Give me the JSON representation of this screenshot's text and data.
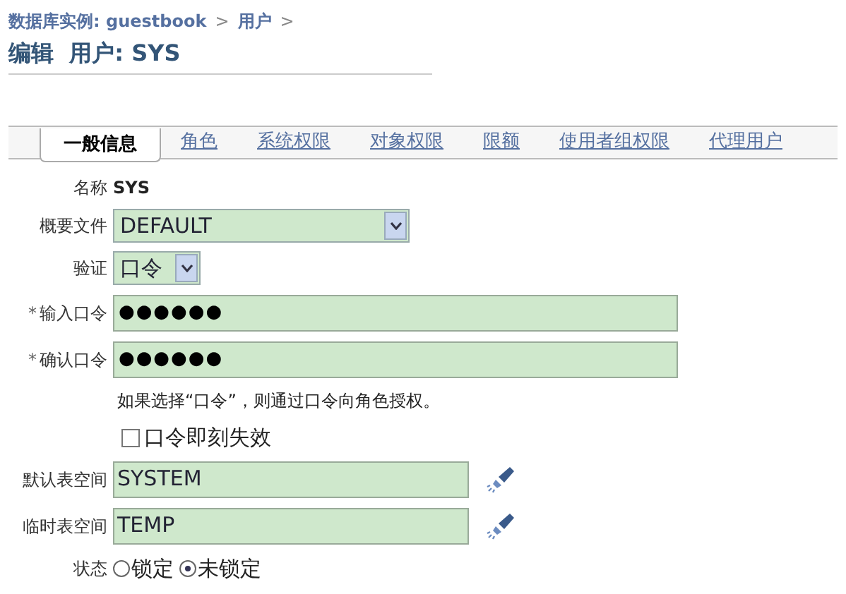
{
  "breadcrumb": [
    {
      "label": "数据库实例: guestbook"
    },
    {
      "label": "用户"
    }
  ],
  "breadcrumb_separator": ">",
  "title": "编辑  用户: SYS",
  "tabs": [
    {
      "label": "一般信息",
      "selected": true
    },
    {
      "label": "角色",
      "selected": false
    },
    {
      "label": "系统权限",
      "selected": false
    },
    {
      "label": "对象权限",
      "selected": false
    },
    {
      "label": "限额",
      "selected": false
    },
    {
      "label": "使用者组权限",
      "selected": false
    },
    {
      "label": "代理用户",
      "selected": false
    }
  ],
  "form": [
    {
      "kind": "text",
      "label": "名称",
      "value": "SYS"
    },
    {
      "kind": "select",
      "label": "概要文件",
      "value": "DEFAULT"
    },
    {
      "kind": "compact",
      "label": "验证",
      "value": "口令"
    },
    {
      "kind": "password",
      "label": "输入口令",
      "required": true,
      "value": "●●●●●●"
    },
    {
      "kind": "password",
      "label": "确认口令",
      "required": true,
      "value": "●●●●●●"
    },
    {
      "kind": "hint",
      "value": "如果选择“口令”，则通过口令向角色授权。"
    },
    {
      "kind": "checkbox",
      "value": "口令即刻失效",
      "checked": false
    },
    {
      "kind": "lookup",
      "label": "默认表空间",
      "value": "SYSTEM"
    },
    {
      "kind": "lookup",
      "label": "临时表空间",
      "value": "TEMP"
    },
    {
      "kind": "radio",
      "label": "状态",
      "options": [
        {
          "label": "锁定",
          "selected": false
        },
        {
          "label": "未锁定",
          "selected": true
        }
      ]
    }
  ],
  "required_mark": "*"
}
